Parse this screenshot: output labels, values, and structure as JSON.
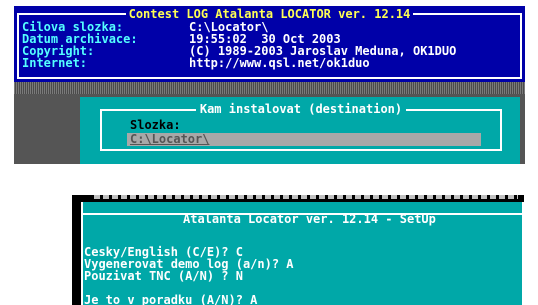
{
  "info_panel": {
    "title": "Contest LOG Atalanta LOCATOR ver. 12.14",
    "rows": [
      {
        "key": "Cilova slozka:",
        "value": "C:\\Locator\\"
      },
      {
        "key": "Datum archivace:",
        "value": "19:55:02  30 Oct 2003"
      },
      {
        "key": "Copyright:",
        "value": "(C) 1989-2003 Jaroslav Meduna, OK1DUO"
      },
      {
        "key": "Internet:",
        "value": "http://www.qsl.net/ok1duo"
      }
    ]
  },
  "install_dialog": {
    "title": "Kam instalovat (destination)",
    "folder_label": "Slozka:",
    "folder_value": "C:\\Locator\\"
  },
  "setup_dialog": {
    "title": "Atalanta Locator ver. 12.14 - SetUp",
    "questions": [
      "Cesky/English (C/E)? C",
      "Vygenerovat demo log (a/n)? A",
      "Pouzivat TNC (A/N) ? N"
    ],
    "confirm": "Je to v poradku (A/N)? A"
  },
  "colors": {
    "dos_blue": "#0000a8",
    "dos_cyan": "#00a8a8",
    "dos_light_cyan": "#54ffff",
    "dos_yellow": "#ffff54",
    "dos_gray": "#555555",
    "input_gray": "#a8a8a8"
  }
}
